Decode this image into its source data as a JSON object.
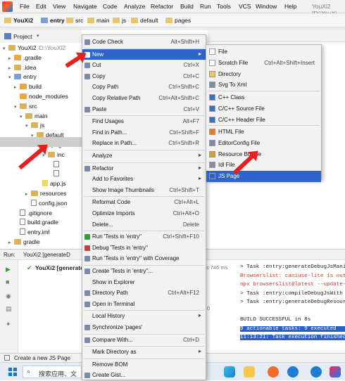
{
  "menubar": {
    "items": [
      "File",
      "Edit",
      "View",
      "Navigate",
      "Code",
      "Analyze",
      "Refactor",
      "Build",
      "Run",
      "Tools",
      "VCS",
      "Window",
      "Help"
    ],
    "window_title": "YouXi2 [D:\\YouXi"
  },
  "breadcrumbs": [
    "YouXi2",
    "entry",
    "src",
    "main",
    "js",
    "default",
    "pages"
  ],
  "project_label": "Project",
  "tree": [
    {
      "label": "YouXi2",
      "extra": "D:\\YouXi2",
      "depth": 0,
      "arrow": "▾",
      "icon": "fold"
    },
    {
      "label": ".gradle",
      "depth": 1,
      "arrow": "▸",
      "icon": "orange"
    },
    {
      "label": ".idea",
      "depth": 1,
      "arrow": "▸",
      "icon": "fold"
    },
    {
      "label": "entry",
      "depth": 1,
      "arrow": "▾",
      "icon": "blue"
    },
    {
      "label": "build",
      "depth": 2,
      "arrow": "▸",
      "icon": "orange"
    },
    {
      "label": "node_modules",
      "depth": 2,
      "arrow": "",
      "icon": "orange"
    },
    {
      "label": "src",
      "depth": 2,
      "arrow": "▾",
      "icon": "fold"
    },
    {
      "label": "main",
      "depth": 3,
      "arrow": "▾",
      "icon": "fold"
    },
    {
      "label": "js",
      "depth": 4,
      "arrow": "▾",
      "icon": "fold"
    },
    {
      "label": "default",
      "depth": 5,
      "arrow": "▾",
      "icon": "fold"
    },
    {
      "label": "pages",
      "depth": 6,
      "arrow": "▾",
      "icon": "fold"
    },
    {
      "label": "inc",
      "depth": 7,
      "arrow": "▾",
      "icon": "fold"
    },
    {
      "label": "",
      "depth": 8,
      "arrow": "",
      "icon": "file"
    },
    {
      "label": "",
      "depth": 8,
      "arrow": "",
      "icon": "file"
    },
    {
      "label": "app.js",
      "depth": 6,
      "arrow": "",
      "icon": "jsf"
    },
    {
      "label": "resources",
      "depth": 4,
      "arrow": "▸",
      "icon": "fold"
    },
    {
      "label": "config.json",
      "depth": 4,
      "arrow": "",
      "icon": "file"
    },
    {
      "label": ".gitignore",
      "depth": 2,
      "arrow": "",
      "icon": "file"
    },
    {
      "label": "build.gradle",
      "depth": 2,
      "arrow": "",
      "icon": "file"
    },
    {
      "label": "entry.iml",
      "depth": 2,
      "arrow": "",
      "icon": "file"
    },
    {
      "label": "gradle",
      "depth": 1,
      "arrow": "▸",
      "icon": "fold"
    }
  ],
  "context_menu": [
    {
      "label": "Code Check",
      "shortcut": "Alt+Shift+H"
    },
    {
      "label": "New",
      "shortcut": "",
      "submenu": true,
      "active": true
    },
    {
      "label": "Cut",
      "shortcut": "Ctrl+X"
    },
    {
      "label": "Copy",
      "shortcut": "Ctrl+C"
    },
    {
      "label": "Copy Path",
      "shortcut": "Ctrl+Shift+C"
    },
    {
      "label": "Copy Relative Path",
      "shortcut": "Ctrl+Alt+Shift+C"
    },
    {
      "label": "Paste",
      "shortcut": "Ctrl+V"
    },
    {
      "label": "Find Usages",
      "shortcut": "Alt+F7"
    },
    {
      "label": "Find in Path...",
      "shortcut": "Ctrl+Shift+F"
    },
    {
      "label": "Replace in Path...",
      "shortcut": "Ctrl+Shift+R"
    },
    {
      "label": "Analyze",
      "shortcut": "",
      "submenu": true
    },
    {
      "label": "Refactor",
      "shortcut": "",
      "submenu": true
    },
    {
      "label": "Add to Favorites",
      "shortcut": "",
      "submenu": true
    },
    {
      "label": "Show Image Thumbnails",
      "shortcut": "Ctrl+Shift+T"
    },
    {
      "label": "Reformat Code",
      "shortcut": "Ctrl+Alt+L"
    },
    {
      "label": "Optimize Imports",
      "shortcut": "Ctrl+Alt+O"
    },
    {
      "label": "Delete...",
      "shortcut": "Delete"
    },
    {
      "label": "Run 'Tests in 'entry''",
      "shortcut": "Ctrl+Shift+F10"
    },
    {
      "label": "Debug 'Tests in 'entry''",
      "shortcut": ""
    },
    {
      "label": "Run 'Tests in 'entry'' with Coverage",
      "shortcut": ""
    },
    {
      "label": "Create 'Tests in 'entry''...",
      "shortcut": ""
    },
    {
      "label": "Show in Explorer",
      "shortcut": ""
    },
    {
      "label": "Directory Path",
      "shortcut": "Ctrl+Alt+F12"
    },
    {
      "label": "Open in Terminal",
      "shortcut": ""
    },
    {
      "label": "Local History",
      "shortcut": "",
      "submenu": true
    },
    {
      "label": "Synchronize 'pages'",
      "shortcut": ""
    },
    {
      "label": "Compare With...",
      "shortcut": "Ctrl+D"
    },
    {
      "label": "Mark Directory as",
      "shortcut": "",
      "submenu": true
    },
    {
      "label": "Remove BOM",
      "shortcut": ""
    },
    {
      "label": "Create Gist...",
      "shortcut": ""
    }
  ],
  "submenu_new": [
    {
      "label": "File",
      "shortcut": ""
    },
    {
      "label": "Scratch File",
      "shortcut": "Ctrl+Alt+Shift+Insert"
    },
    {
      "label": "Directory",
      "shortcut": ""
    },
    {
      "label": "Svg To Xml",
      "shortcut": ""
    },
    {
      "label": "C++ Class",
      "shortcut": ""
    },
    {
      "label": "C/C++ Source File",
      "shortcut": ""
    },
    {
      "label": "C/C++ Header File",
      "shortcut": ""
    },
    {
      "label": "HTML File",
      "shortcut": ""
    },
    {
      "label": "EditorConfig File",
      "shortcut": ""
    },
    {
      "label": "Resource Bundle",
      "shortcut": ""
    },
    {
      "label": "Idl File",
      "shortcut": ""
    },
    {
      "label": "JS Page",
      "shortcut": "",
      "active": true
    }
  ],
  "run": {
    "tab_label": "Run:",
    "config": "YouXi2 [generateD",
    "tree_item": "YouXi2 [generate",
    "elapsed": "s 746 ms",
    "zero": "0"
  },
  "console": [
    "> Task :entry:generateDebugJsMani",
    "Browserslist: caniuse-lite is out",
    "npx browserslist@latest --update-",
    "> Task :entry:compileDebugJsWith",
    "> Task :entry:generateDebugResour",
    "",
    "BUILD SUCCESSFUL in 8s",
    "9 actionable tasks: 9 executed",
    "11:13:21: Task execution finished"
  ],
  "status": {
    "text": "Create a new JS Page"
  },
  "taskbar": {
    "search_placeholder": "搜索应用、文"
  },
  "colors": {
    "accent": "#2f65ca",
    "arrow": "#e5211f"
  }
}
